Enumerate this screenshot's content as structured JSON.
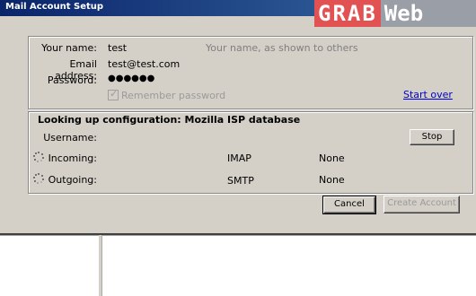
{
  "window": {
    "title": "Mail Account Setup"
  },
  "watermark": {
    "part_a": "GRAB",
    "part_b": "Web"
  },
  "form": {
    "name_label": "Your name:",
    "name_value": "test",
    "name_hint": "Your name, as shown to others",
    "email_label": "Email address:",
    "email_value": "test@test.com",
    "password_label": "Password:",
    "password_value": "●●●●●●",
    "remember_label": "Remember password",
    "remember_checked": true,
    "start_over": "Start over"
  },
  "lookup": {
    "heading": "Looking up configuration: Mozilla ISP database",
    "username_label": "Username:",
    "stop_label": "Stop",
    "incoming_label": "Incoming:",
    "incoming_protocol": "IMAP",
    "incoming_security": "None",
    "outgoing_label": "Outgoing:",
    "outgoing_protocol": "SMTP",
    "outgoing_security": "None"
  },
  "actions": {
    "cancel_label": "Cancel",
    "create_label": "Create Account"
  },
  "colors": {
    "dialog_bg": "#d4d0c8",
    "titlebar": "#0a246a",
    "link": "#0000cc",
    "watermark_red": "#e25252",
    "watermark_gray": "#9a9ea6"
  }
}
